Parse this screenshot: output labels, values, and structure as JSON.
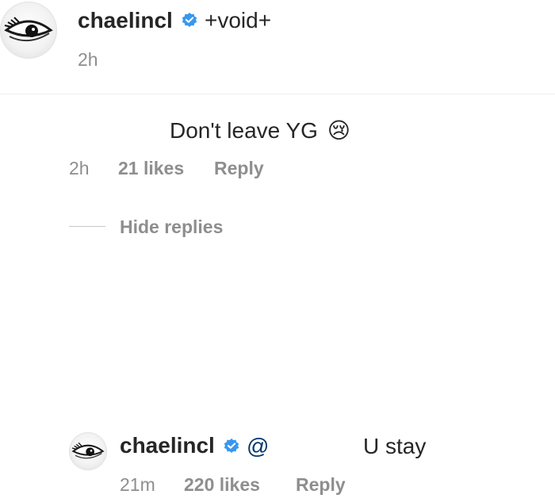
{
  "post": {
    "username": "chaelincl",
    "caption": "+void+",
    "time": "2h"
  },
  "comment": {
    "text": "Don't leave YG",
    "emoji": "😢",
    "time": "2h",
    "likes": "21 likes",
    "reply_label": "Reply",
    "hide_replies_label": "Hide replies"
  },
  "reply": {
    "username": "chaelincl",
    "mention": "@",
    "text": "U stay",
    "time": "21m",
    "likes": "220 likes",
    "reply_label": "Reply"
  },
  "colors": {
    "verified_blue": "#3897f0",
    "text": "#262626",
    "secondary": "#8e8e8e"
  },
  "icons": {
    "verified": "verified-badge-icon",
    "avatar": "eye-avatar-icon"
  }
}
